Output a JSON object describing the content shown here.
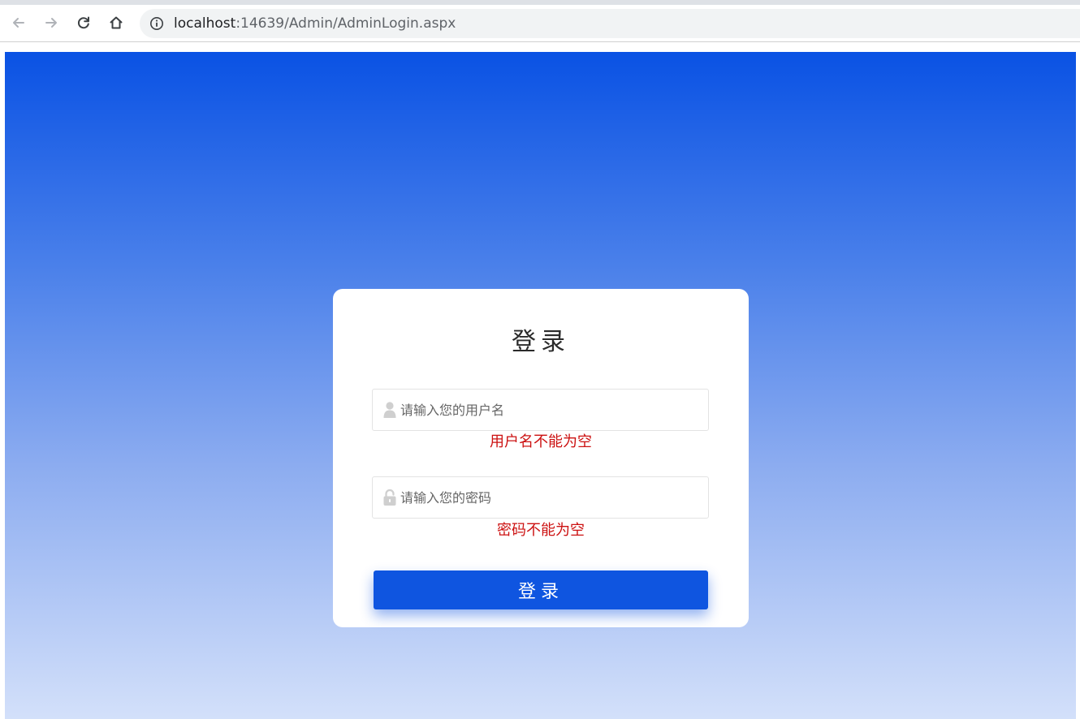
{
  "browser": {
    "url_host": "localhost",
    "url_rest": ":14639/Admin/AdminLogin.aspx",
    "icons": {
      "back": "arrow-left-icon",
      "forward": "arrow-right-icon",
      "reload": "reload-icon",
      "home": "home-icon",
      "info": "info-icon"
    }
  },
  "login": {
    "title": "登录",
    "username": {
      "placeholder": "请输入您的用户名",
      "value": "",
      "icon": "user-icon",
      "error": "用户名不能为空"
    },
    "password": {
      "placeholder": "请输入您的密码",
      "value": "",
      "icon": "lock-icon",
      "error": "密码不能为空"
    },
    "button_label": "登录"
  },
  "colors": {
    "accent": "#0f55e0",
    "error": "#cc1111",
    "gradient_top": "#0a52e4",
    "gradient_bottom": "#d3e0fa"
  }
}
